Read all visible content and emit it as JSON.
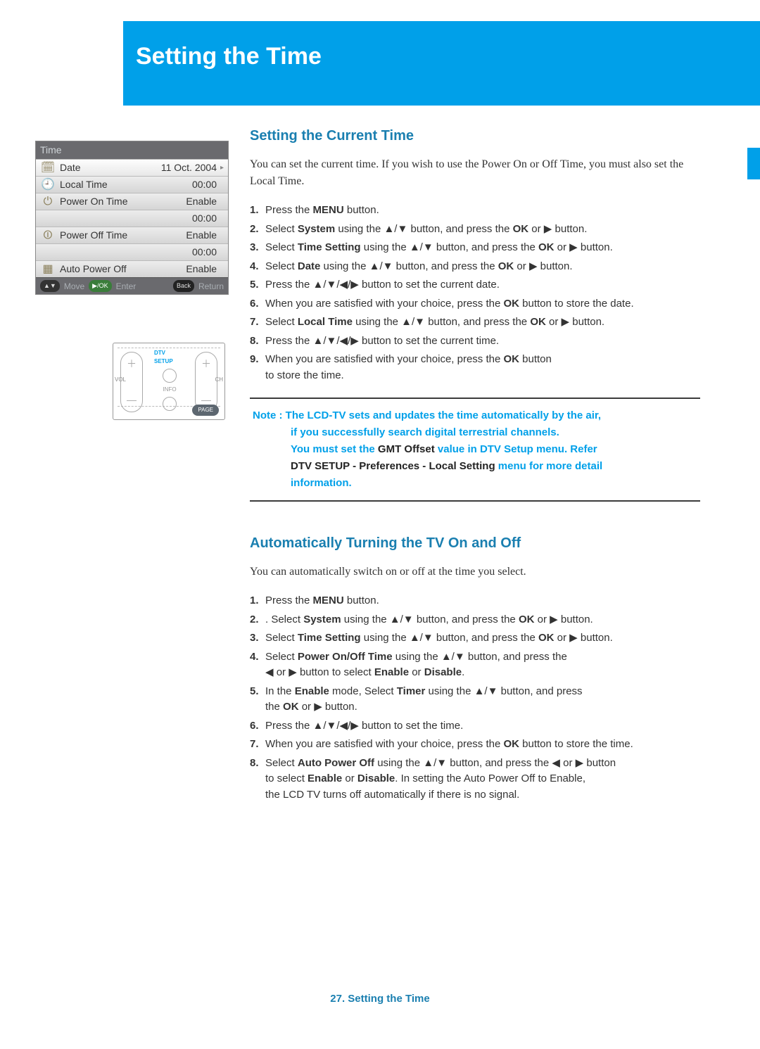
{
  "banner": {
    "title": "Setting the Time"
  },
  "section1": {
    "heading": "Setting the Current Time",
    "intro": "You can set the current time. If you wish to use the Power On or Off Time, you must also set the Local Time.",
    "steps": {
      "s1a": "Press the ",
      "s1b": "MENU",
      "s1c": " button.",
      "s2a": "Select ",
      "s2b": "System",
      "s2c": " using the ",
      "s2d": "▲/▼",
      "s2e": " button, and press the ",
      "s2f": "OK",
      "s2g": " or ",
      "s2h": "▶",
      "s2i": " button.",
      "s3a": "Select ",
      "s3b": "Time Setting",
      "s3c": " using the ",
      "s3d": "▲/▼",
      "s3e": " button, and press the ",
      "s3f": "OK",
      "s3g": " or ",
      "s3h": "▶",
      "s3i": " button.",
      "s4a": "Select ",
      "s4b": "Date",
      "s4c": " using the ",
      "s4d": "▲/▼",
      "s4e": " button, and press the ",
      "s4f": "OK",
      "s4g": " or ",
      "s4h": "▶",
      "s4i": " button.",
      "s5a": "Press the ",
      "s5b": "▲/▼/◀/▶",
      "s5c": " button to set the current date.",
      "s6a": "When you are satisfied with your choice, press the ",
      "s6b": "OK",
      "s6c": " button to store the date.",
      "s7a": "Select ",
      "s7b": "Local Time",
      "s7c": " using the ",
      "s7d": "▲/▼",
      "s7e": " button, and press the ",
      "s7f": "OK",
      "s7g": " or ",
      "s7h": "▶",
      "s7i": " button.",
      "s8a": "Press the ",
      "s8b": "▲/▼/◀/▶",
      "s8c": " button to set the current time.",
      "s9a": "When you are satisfied with your choice, press the ",
      "s9b": "OK",
      "s9c": "  button",
      "s9d": "to store the time."
    }
  },
  "note": {
    "prefix": "Note : ",
    "l1": "The LCD-TV sets and updates the time automatically by the air,",
    "l2": "if you successfully search digital terrestrial channels.",
    "l3a": "You must set the ",
    "l3b": "GMT Offset",
    "l3c": " value in DTV Setup menu. Refer",
    "l4a": "DTV SETUP - Preferences - Local Setting",
    "l4b": " menu for more detail",
    "l5": "information."
  },
  "section2": {
    "heading": "Automatically Turning the TV On and Off",
    "intro": "You can automatically switch on or off at the time you select.",
    "steps": {
      "s1a": "Press the ",
      "s1b": "MENU",
      "s1c": " button.",
      "s2a": ". Select ",
      "s2b": "System",
      "s2c": " using the ",
      "s2d": "▲/▼",
      "s2e": " button, and press the ",
      "s2f": "OK",
      "s2g": " or ",
      "s2h": "▶",
      "s2i": " button.",
      "s3a": "Select ",
      "s3b": "Time Setting",
      "s3c": " using the ",
      "s3d": "▲/▼",
      "s3e": " button, and press the ",
      "s3f": "OK",
      "s3g": " or ",
      "s3h": "▶",
      "s3i": " button.",
      "s4a": "Select ",
      "s4b": "Power On/Off Time",
      "s4c": " using the ",
      "s4d": "▲/▼",
      "s4e": " button, and press the",
      "s4f": "◀",
      "s4g": " or ",
      "s4h": "▶",
      "s4i": " button to select ",
      "s4j": "Enable",
      "s4k": " or ",
      "s4l": "Disable",
      "s4m": ".",
      "s5a": "In the ",
      "s5b": "Enable",
      "s5c": " mode, Select ",
      "s5d": "Timer",
      "s5e": " using the ",
      "s5f": "▲/▼",
      "s5g": " button, and press",
      "s5h": "the ",
      "s5i": "OK",
      "s5j": " or ",
      "s5k": "▶",
      "s5l": " button.",
      "s6a": "Press the ",
      "s6b": "▲/▼/◀/▶",
      "s6c": " button to set the time.",
      "s7a": "When you are satisfied with your choice, press the ",
      "s7b": "OK",
      "s7c": " button to store the time.",
      "s8a": "Select ",
      "s8b": "Auto Power Off",
      "s8c": " using the ",
      "s8d": "▲/▼",
      "s8e": " button, and press the ",
      "s8f": "◀",
      "s8g": " or ",
      "s8h": "▶",
      "s8i": " button",
      "s8j": "to select ",
      "s8k": "Enable",
      "s8l": " or ",
      "s8m": "Disable",
      "s8n": ". In setting the Auto Power Off to Enable,",
      "s8o": "the LCD TV turns off automatically if there is no signal."
    }
  },
  "osd": {
    "title": "Time",
    "rows": [
      {
        "icon": "calendar-icon",
        "glyph": "🗓",
        "label": "Date",
        "value": "11 Oct. 2004",
        "arrow": "▸"
      },
      {
        "icon": "clock-icon",
        "glyph": "🕘",
        "label": "Local Time",
        "value": "00:00",
        "arrow": ""
      },
      {
        "icon": "power-on-icon",
        "glyph": "⏻",
        "label": "Power On Time",
        "value": "Enable",
        "arrow": ""
      },
      {
        "icon": "",
        "glyph": "",
        "label": "",
        "value": "00:00",
        "arrow": ""
      },
      {
        "icon": "power-off-icon",
        "glyph": "⏼",
        "label": "Power Off Time",
        "value": "Enable",
        "arrow": ""
      },
      {
        "icon": "",
        "glyph": "",
        "label": "",
        "value": "00:00",
        "arrow": ""
      },
      {
        "icon": "auto-off-icon",
        "glyph": "▦",
        "label": "Auto Power Off",
        "value": "Enable",
        "arrow": ""
      }
    ],
    "foot": {
      "move": "Move",
      "enter": "Enter",
      "back": "Back",
      "return": "Return",
      "okglyph": "▶/OK"
    }
  },
  "remote": {
    "dtv": "DTV SETUP",
    "info": "INFO",
    "vol": "VOL",
    "ch": "CH",
    "page": "PAGE",
    "plus": "＋",
    "minus": "—"
  },
  "footer": "27. Setting the Time"
}
